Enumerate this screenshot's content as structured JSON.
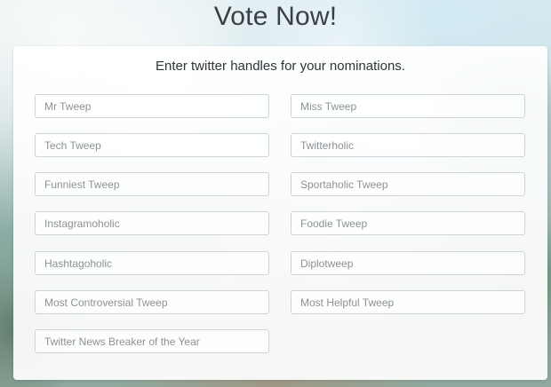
{
  "header": {
    "title": "Vote Now!"
  },
  "form": {
    "subtitle": "Enter twitter handles for your nominations.",
    "fields": {
      "mr_tweep": {
        "placeholder": "Mr Tweep",
        "value": ""
      },
      "miss_tweep": {
        "placeholder": "Miss Tweep",
        "value": ""
      },
      "tech_tweep": {
        "placeholder": "Tech Tweep",
        "value": ""
      },
      "twitterholic": {
        "placeholder": "Twitterholic",
        "value": ""
      },
      "funniest_tweep": {
        "placeholder": "Funniest Tweep",
        "value": ""
      },
      "sportaholic_tweep": {
        "placeholder": "Sportaholic Tweep",
        "value": ""
      },
      "instagramoholic": {
        "placeholder": "Instagramoholic",
        "value": ""
      },
      "foodie_tweep": {
        "placeholder": "Foodie Tweep",
        "value": ""
      },
      "hashtagoholic": {
        "placeholder": "Hashtagoholic",
        "value": ""
      },
      "diplotweep": {
        "placeholder": "Diplotweep",
        "value": ""
      },
      "most_controversial_tweep": {
        "placeholder": "Most Controversial Tweep",
        "value": ""
      },
      "most_helpful_tweep": {
        "placeholder": "Most Helpful Tweep",
        "value": ""
      },
      "twitter_news_breaker": {
        "placeholder": "Twitter News Breaker of the Year",
        "value": ""
      }
    }
  }
}
